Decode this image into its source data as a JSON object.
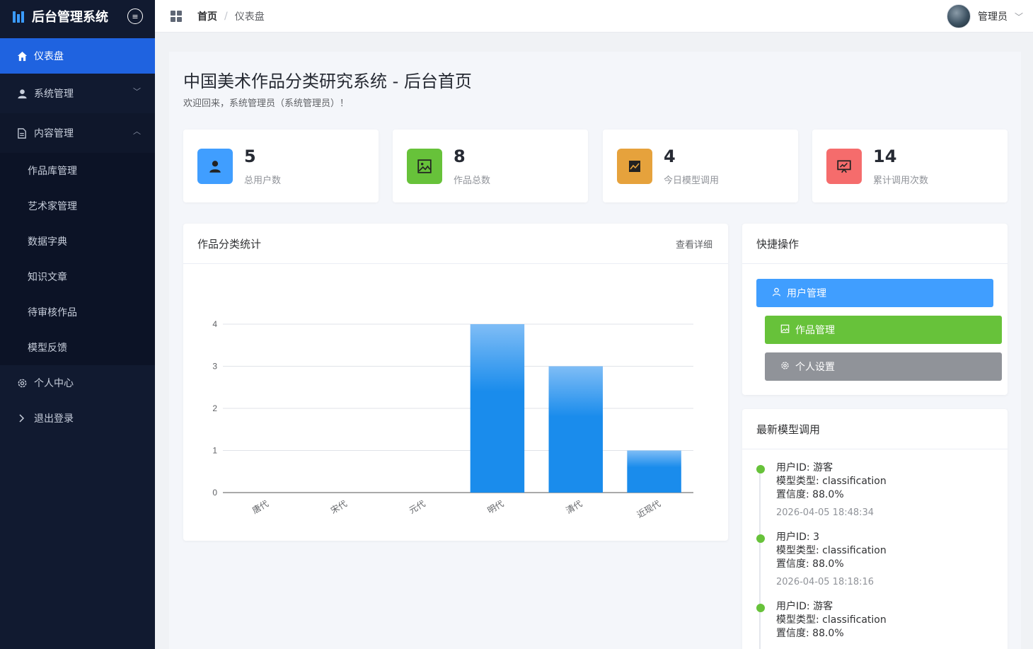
{
  "app": {
    "title": "后台管理系统"
  },
  "sidebar": {
    "items": [
      {
        "label": "仪表盘"
      },
      {
        "label": "系统管理"
      },
      {
        "label": "内容管理"
      },
      {
        "label": "作品库管理"
      },
      {
        "label": "艺术家管理"
      },
      {
        "label": "数据字典"
      },
      {
        "label": "知识文章"
      },
      {
        "label": "待审核作品"
      },
      {
        "label": "模型反馈"
      },
      {
        "label": "个人中心"
      },
      {
        "label": "退出登录"
      }
    ]
  },
  "header": {
    "breadcrumb": [
      "首页",
      "/",
      "仪表盘"
    ],
    "user_name": "管理员"
  },
  "page": {
    "title": "中国美术作品分类研究系统 - 后台首页",
    "welcome": "欢迎回来，系统管理员（系统管理员）！"
  },
  "stats": [
    {
      "value": "5",
      "label": "总用户数",
      "color": "#409eff",
      "icon": "user-icon"
    },
    {
      "value": "8",
      "label": "作品总数",
      "color": "#67c23a",
      "icon": "picture-icon"
    },
    {
      "value": "4",
      "label": "今日模型调用",
      "color": "#e6a23c",
      "icon": "trend-chart-icon"
    },
    {
      "value": "14",
      "label": "累计调用次数",
      "color": "#f56c6c",
      "icon": "presentation-icon"
    }
  ],
  "chart_panel": {
    "title": "作品分类统计",
    "more": "查看详细"
  },
  "chart_data": {
    "type": "bar",
    "categories": [
      "唐代",
      "宋代",
      "元代",
      "明代",
      "清代",
      "近现代"
    ],
    "values": [
      0,
      0,
      0,
      4,
      3,
      1
    ],
    "ylim": [
      0,
      4
    ],
    "yticks": [
      "0",
      "1",
      "2",
      "3",
      "4"
    ],
    "bar_color": "#1a8cec",
    "grid": true
  },
  "quick_panel": {
    "title": "快捷操作",
    "buttons": [
      {
        "label": "用户管理",
        "color": "#409eff"
      },
      {
        "label": "作品管理",
        "color": "#67c23a"
      },
      {
        "label": "个人设置",
        "color": "#909399"
      }
    ]
  },
  "recent_panel": {
    "title": "最新模型调用",
    "entries": [
      {
        "user": "用户ID: 游客",
        "type": "模型类型: classification",
        "conf": "置信度: 88.0%",
        "time": "2026-04-05 18:48:34"
      },
      {
        "user": "用户ID: 3",
        "type": "模型类型: classification",
        "conf": "置信度: 88.0%",
        "time": "2026-04-05 18:18:16"
      },
      {
        "user": "用户ID: 游客",
        "type": "模型类型: classification",
        "conf": "置信度: 88.0%",
        "time": ""
      }
    ]
  }
}
